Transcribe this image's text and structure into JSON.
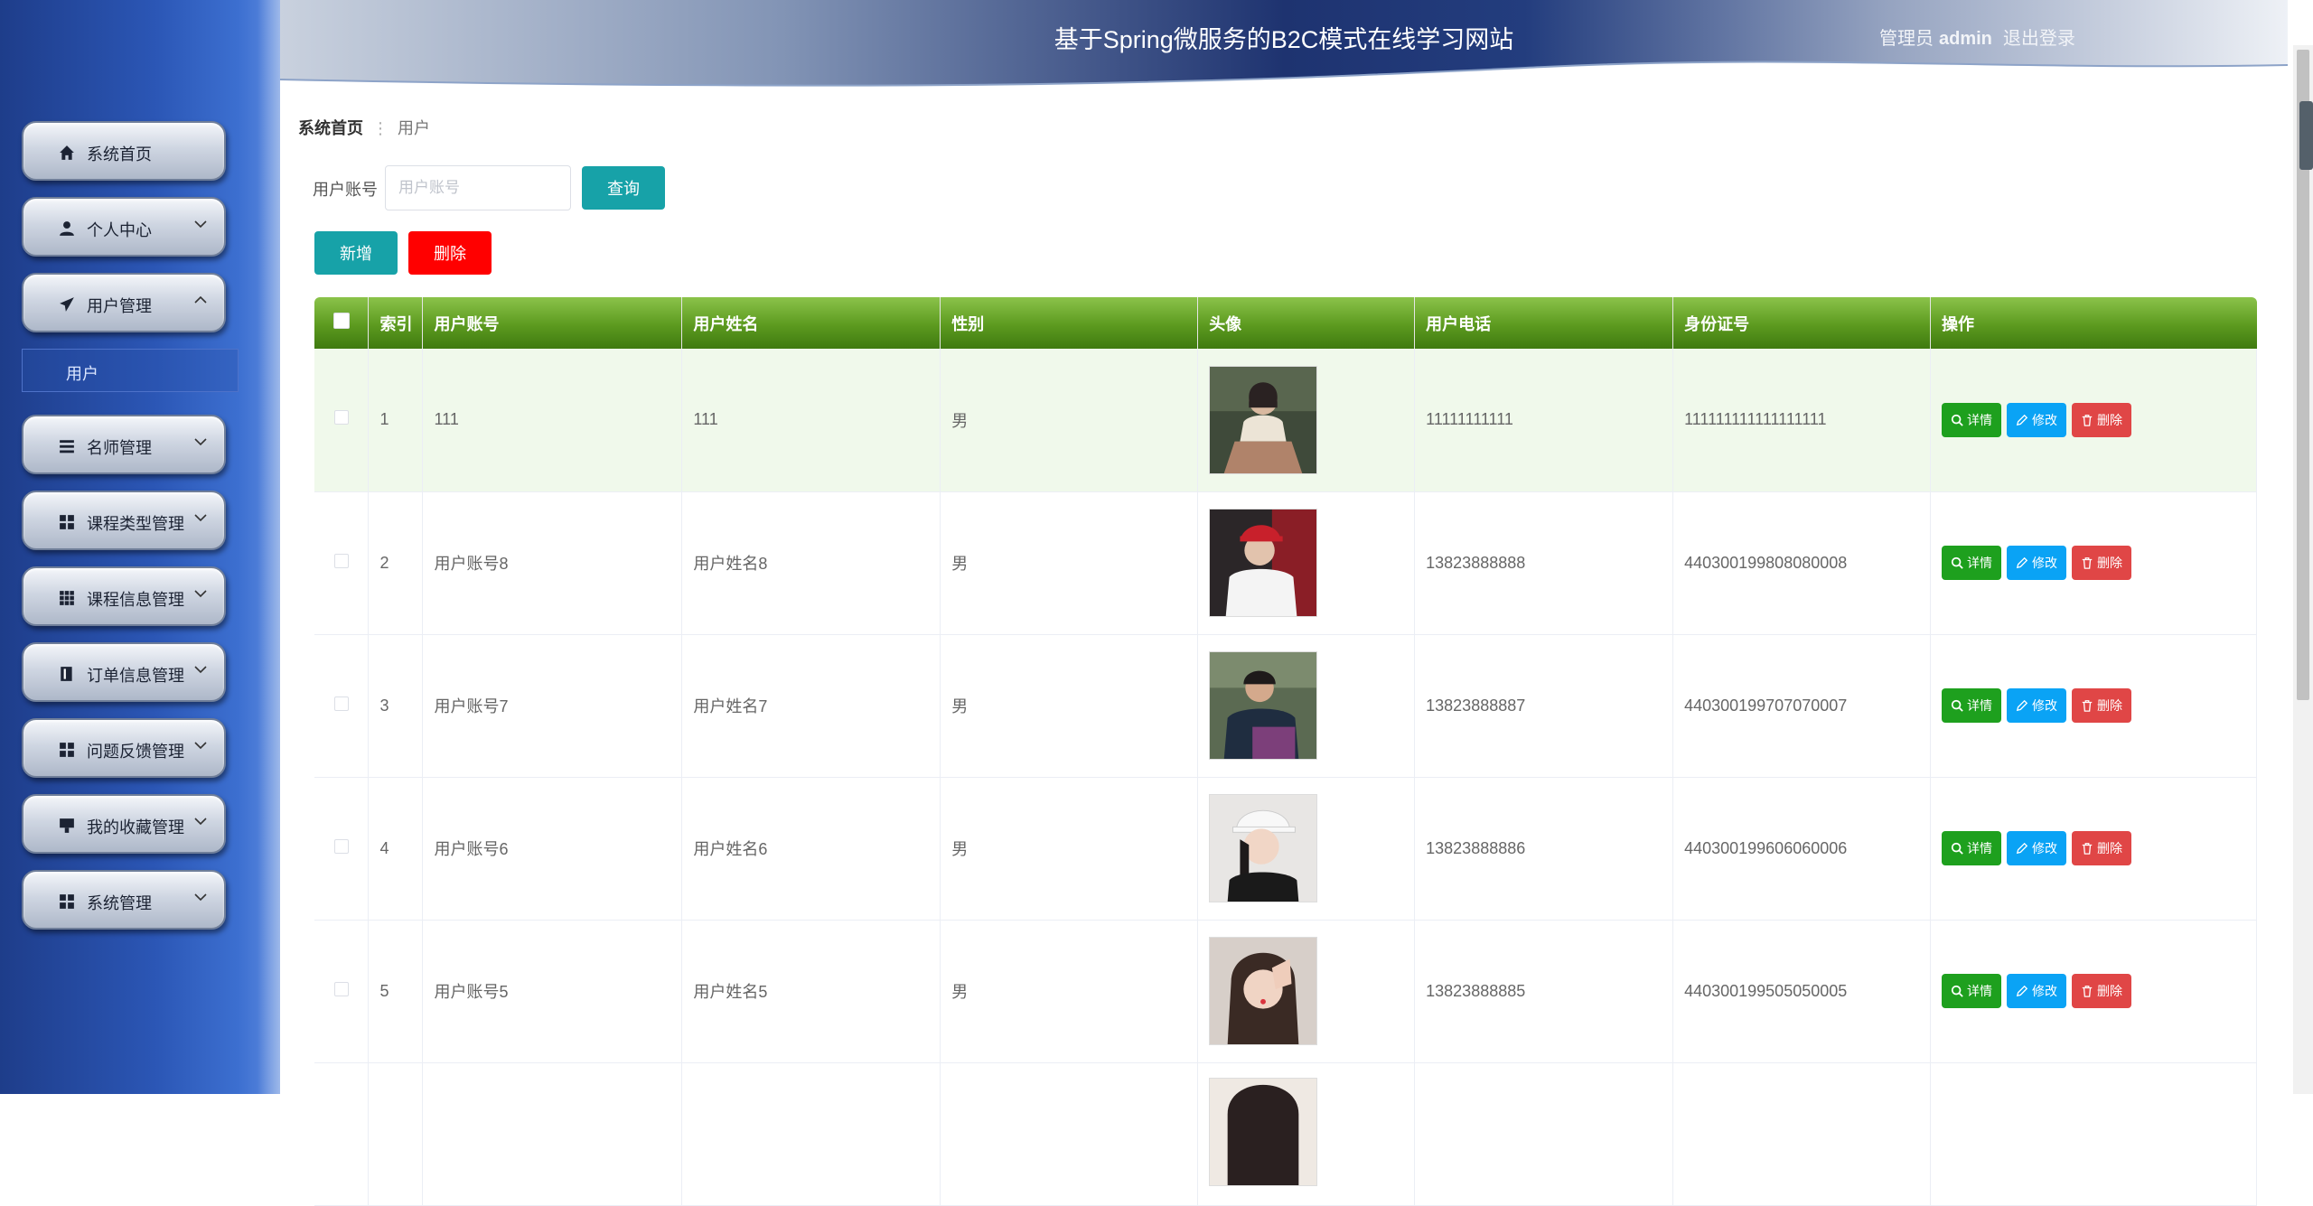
{
  "header": {
    "title": "基于Spring微服务的B2C模式在线学习网站",
    "role": "管理员",
    "username": "admin",
    "logout": "退出登录"
  },
  "sidebar": {
    "items": [
      {
        "label": "系统首页",
        "icon": "home-icon"
      },
      {
        "label": "个人中心",
        "icon": "user-icon"
      },
      {
        "label": "用户管理",
        "icon": "send-icon"
      },
      {
        "label": "名师管理",
        "icon": "list-icon"
      },
      {
        "label": "课程类型管理",
        "icon": "grid-icon"
      },
      {
        "label": "课程信息管理",
        "icon": "grid-icon"
      },
      {
        "label": "订单信息管理",
        "icon": "book-icon"
      },
      {
        "label": "问题反馈管理",
        "icon": "grid-icon"
      },
      {
        "label": "我的收藏管理",
        "icon": "pin-icon"
      },
      {
        "label": "系统管理",
        "icon": "grid-icon"
      }
    ],
    "sub_item": "用户"
  },
  "breadcrumb": {
    "home": "系统首页",
    "current": "用户"
  },
  "search": {
    "label": "用户账号",
    "placeholder": "用户账号",
    "value": "",
    "button": "查询"
  },
  "actions": {
    "add": "新增",
    "delete": "删除"
  },
  "table": {
    "headers": [
      "索引",
      "用户账号",
      "用户姓名",
      "性别",
      "头像",
      "用户电话",
      "身份证号",
      "操作"
    ],
    "row_actions": {
      "detail": "详情",
      "edit": "修改",
      "remove": "删除"
    },
    "rows": [
      {
        "index": "1",
        "account": "111",
        "name": "111",
        "gender": "男",
        "phone": "11111111111",
        "id_card": "111111111111111111"
      },
      {
        "index": "2",
        "account": "用户账号8",
        "name": "用户姓名8",
        "gender": "男",
        "phone": "13823888888",
        "id_card": "440300199808080008"
      },
      {
        "index": "3",
        "account": "用户账号7",
        "name": "用户姓名7",
        "gender": "男",
        "phone": "13823888887",
        "id_card": "440300199707070007"
      },
      {
        "index": "4",
        "account": "用户账号6",
        "name": "用户姓名6",
        "gender": "男",
        "phone": "13823888886",
        "id_card": "440300199606060006"
      },
      {
        "index": "5",
        "account": "用户账号5",
        "name": "用户姓名5",
        "gender": "男",
        "phone": "13823888885",
        "id_card": "440300199505050005"
      }
    ]
  },
  "colors": {
    "sidebar": "#2b56b5",
    "table_header": "#5c9a1f",
    "query_button": "#17a2a8",
    "delete_button": "#ff0000",
    "detail": "#1ea01e",
    "edit": "#0aa3f5",
    "remove": "#e04646"
  }
}
